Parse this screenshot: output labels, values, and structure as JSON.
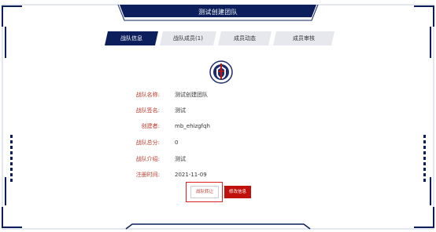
{
  "window": {
    "title": "测试创建团队"
  },
  "tabs": [
    {
      "label": "战队信息",
      "active": true
    },
    {
      "label": "战队成员(1)",
      "active": false
    },
    {
      "label": "成员动态",
      "active": false
    },
    {
      "label": "成员审核",
      "active": false
    }
  ],
  "team_info": {
    "name_label": "战队名称:",
    "name_value": "测试创建团队",
    "sign_label": "战队签名:",
    "sign_value": "测试",
    "creator_label": "创建者:",
    "creator_value": "mb_ehizgfqh",
    "score_label": "战队总分:",
    "score_value": "0",
    "intro_label": "战队介绍:",
    "intro_value": "测试",
    "date_label": "注册时间:",
    "date_value": "2021-11-09"
  },
  "actions": {
    "transfer_label": "战队转让",
    "edit_label": "修改信息"
  },
  "colors": {
    "frame_navy": "#0c1f5c",
    "label_red": "#c0392b",
    "edit_button_red": "#c0110c",
    "highlight_red": "#e02020"
  },
  "icons": {
    "team_logo": "team-emblem-icon"
  }
}
